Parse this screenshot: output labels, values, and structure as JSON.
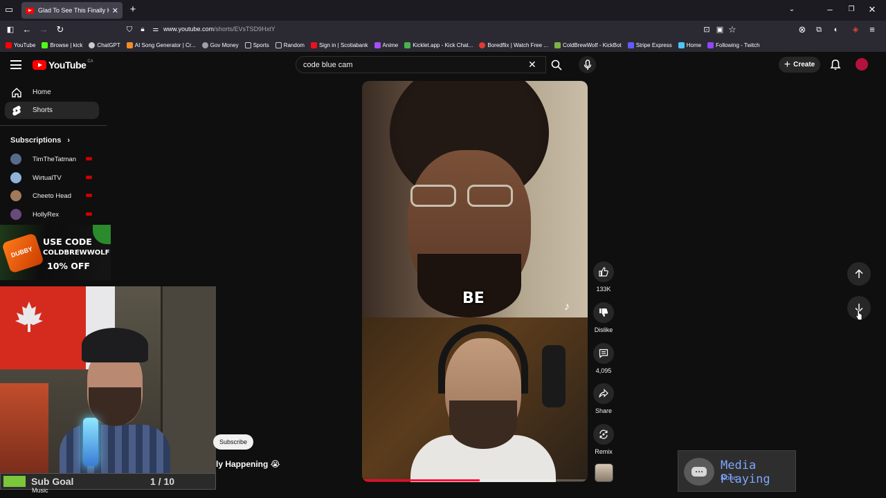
{
  "browser": {
    "tab_title": "Glad To See This Finally Ha",
    "url_host": "www.youtube.com",
    "url_path": "/shorts/EVsTSD9HxtY",
    "bookmarks": [
      {
        "label": "YouTube",
        "color": "#ff0000"
      },
      {
        "label": "Browse | kick",
        "color": "#53fc18"
      },
      {
        "label": "ChatGPT",
        "color": "#cccccc"
      },
      {
        "label": "AI Song Generator | Cr...",
        "color": "#f28c28"
      },
      {
        "label": "Gov Money",
        "color": "#9aa0a6"
      },
      {
        "label": "Sports",
        "color": "#9aa0a6"
      },
      {
        "label": "Random",
        "color": "#9aa0a6"
      },
      {
        "label": "Sign in | Scotiabank",
        "color": "#ec111a"
      },
      {
        "label": "Anime",
        "color": "#a64dff"
      },
      {
        "label": "Kicklet.app - Kick Chat...",
        "color": "#4caf50"
      },
      {
        "label": "Boredflix | Watch Free ...",
        "color": "#e53935"
      },
      {
        "label": "ColdBrewWolf - KickBot",
        "color": "#7cb342"
      },
      {
        "label": "Stripe Express",
        "color": "#635bff"
      },
      {
        "label": "Home",
        "color": "#4fc3f7"
      },
      {
        "label": "Following - Twitch",
        "color": "#9146ff"
      }
    ]
  },
  "youtube": {
    "logo_text": "YouTube",
    "logo_country": "CA",
    "search_value": "code blue cam",
    "create_label": "Create"
  },
  "sidebar": {
    "items": [
      {
        "label": "Home"
      },
      {
        "label": "Shorts"
      }
    ],
    "subscriptions_heading": "Subscriptions",
    "subscriptions": [
      {
        "name": "TimTheTatman",
        "color": "#5a6a8a"
      },
      {
        "name": "WirtualTV",
        "color": "#8fb4d8"
      },
      {
        "name": "Cheeto Head",
        "color": "#a07a5a"
      },
      {
        "name": "HollyRex",
        "color": "#6a4a7a"
      }
    ]
  },
  "ad": {
    "line1": "USE CODE",
    "line2": "COLDBREWWOLF",
    "line3": "10% OFF"
  },
  "overlay": {
    "subscribe_label": "Subscribe",
    "short_title": "ly Happening 😭",
    "sub_goal_label": "Sub Goal",
    "sub_goal_count": "1 / 10",
    "sub_goal_fraction": 0.1,
    "music_label": "Music"
  },
  "short": {
    "caption": "BE",
    "progress_fraction": 0.52,
    "likes": "133K",
    "dislike_label": "Dislike",
    "comments": "4,095",
    "share_label": "Share",
    "remix_label": "Remix"
  },
  "media_widget": {
    "title": "Media Playing",
    "subtitle": "None"
  }
}
